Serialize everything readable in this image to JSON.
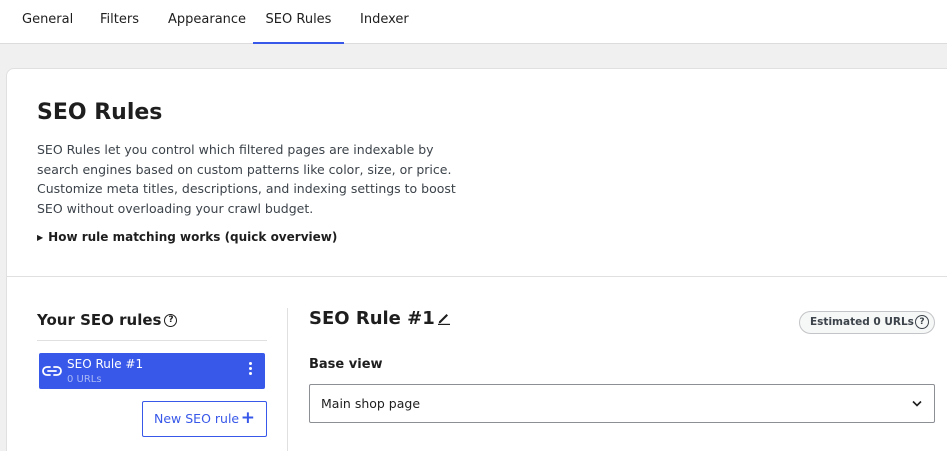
{
  "tabs": [
    {
      "label": "General"
    },
    {
      "label": "Filters"
    },
    {
      "label": "Appearance"
    },
    {
      "label": "SEO Rules"
    },
    {
      "label": "Indexer"
    }
  ],
  "active_tab": "SEO Rules",
  "page": {
    "title": "SEO Rules",
    "description": "SEO Rules let you control which filtered pages are indexable by search engines based on custom patterns like color, size, or price. Customize meta titles, descriptions, and indexing settings to boost SEO without overloading your crawl budget.",
    "details_label": "How rule matching works (quick overview)"
  },
  "sidebar": {
    "title": "Your SEO rules",
    "help_icon": "question-circle-icon",
    "rules": [
      {
        "name": "SEO Rule #1",
        "count": "0 URLs",
        "icon": "link-icon"
      }
    ],
    "new_rule_label": "New SEO rule"
  },
  "editor": {
    "title": "SEO Rule #1",
    "estimate_prefix": "Estimated",
    "estimate_count": "0",
    "estimate_suffix": "URLs",
    "base_view_label": "Base view",
    "base_view_value": "Main shop page"
  },
  "colors": {
    "accent": "#3858e9",
    "background": "#f0f0f1",
    "card": "#ffffff"
  }
}
